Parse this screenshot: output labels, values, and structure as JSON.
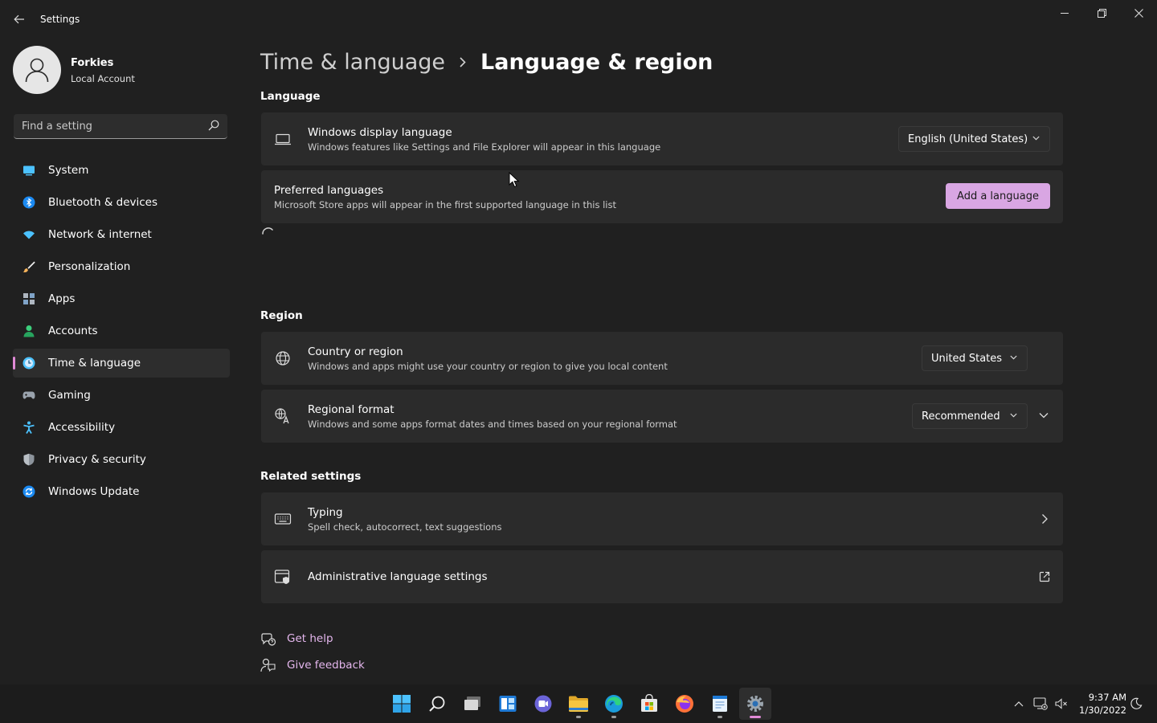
{
  "window": {
    "title": "Settings"
  },
  "profile": {
    "name": "Forkies",
    "account_type": "Local Account"
  },
  "search": {
    "placeholder": "Find a setting"
  },
  "sidebar": {
    "items": [
      {
        "label": "System",
        "icon": "system-icon"
      },
      {
        "label": "Bluetooth & devices",
        "icon": "bluetooth-icon"
      },
      {
        "label": "Network & internet",
        "icon": "network-icon"
      },
      {
        "label": "Personalization",
        "icon": "brush-icon"
      },
      {
        "label": "Apps",
        "icon": "apps-icon"
      },
      {
        "label": "Accounts",
        "icon": "accounts-icon"
      },
      {
        "label": "Time & language",
        "icon": "time-language-icon",
        "active": true
      },
      {
        "label": "Gaming",
        "icon": "gamepad-icon"
      },
      {
        "label": "Accessibility",
        "icon": "accessibility-icon"
      },
      {
        "label": "Privacy & security",
        "icon": "shield-icon"
      },
      {
        "label": "Windows Update",
        "icon": "update-icon"
      }
    ]
  },
  "breadcrumb": {
    "parent": "Time & language",
    "current": "Language & region"
  },
  "language": {
    "heading": "Language",
    "display": {
      "title": "Windows display language",
      "desc": "Windows features like Settings and File Explorer will appear in this language",
      "value": "English (United States)"
    },
    "preferred": {
      "title": "Preferred languages",
      "desc": "Microsoft Store apps will appear in the first supported language in this list",
      "button": "Add a language"
    }
  },
  "region": {
    "heading": "Region",
    "country": {
      "title": "Country or region",
      "desc": "Windows and apps might use your country or region to give you local content",
      "value": "United States"
    },
    "format": {
      "title": "Regional format",
      "desc": "Windows and some apps format dates and times based on your regional format",
      "value": "Recommended"
    }
  },
  "related": {
    "heading": "Related settings",
    "typing": {
      "title": "Typing",
      "desc": "Spell check, autocorrect, text suggestions"
    },
    "admin": {
      "title": "Administrative language settings"
    }
  },
  "help": {
    "get_help": "Get help",
    "feedback": "Give feedback"
  },
  "taskbar": {
    "apps": [
      "start",
      "search",
      "task-view",
      "widgets",
      "chat",
      "file-explorer",
      "edge",
      "store",
      "firefox",
      "notepad",
      "settings"
    ],
    "time": "9:37 AM",
    "date": "1/30/2022"
  },
  "colors": {
    "accent": "#d9a6e3",
    "link": "#e5b7ee",
    "background": "#202020",
    "card": "#2b2b2b"
  }
}
